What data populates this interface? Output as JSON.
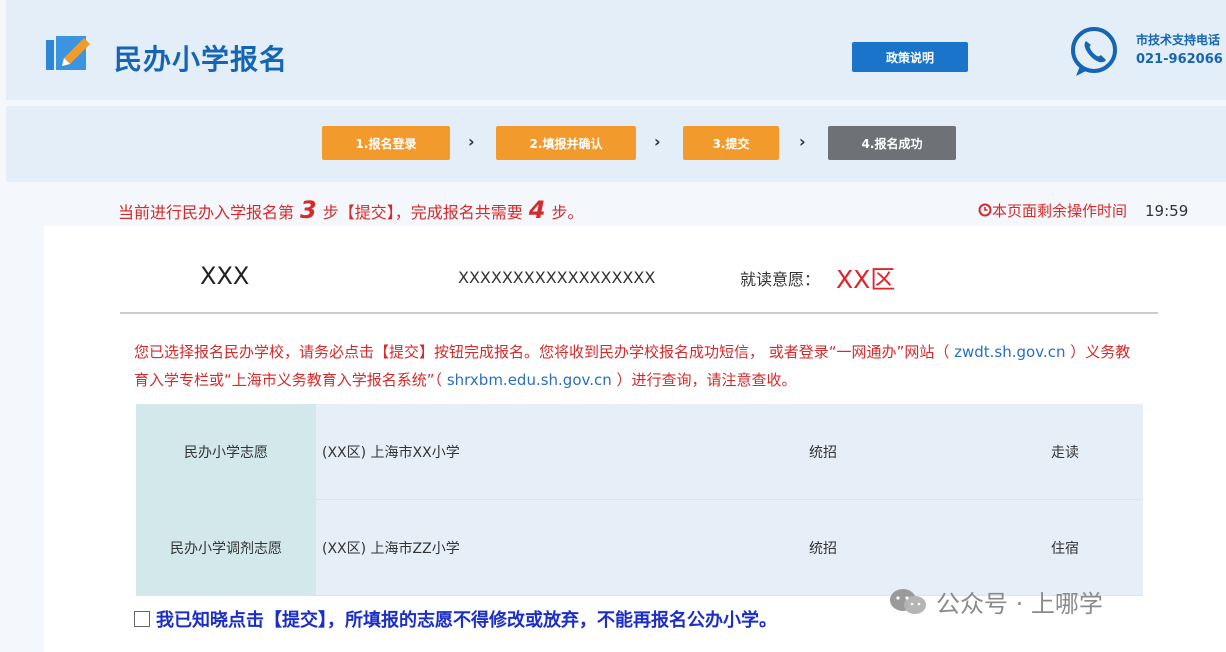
{
  "header": {
    "title": "民办小学报名",
    "policy_button": "政策说明",
    "support_label": "市技术支持电话",
    "support_phone": "021-962066"
  },
  "steps": [
    {
      "label": "1.报名登录",
      "state": "done"
    },
    {
      "label": "2.填报并确认",
      "state": "done"
    },
    {
      "label": "3.提交",
      "state": "done"
    },
    {
      "label": "4.报名成功",
      "state": "todo"
    }
  ],
  "step_arrow": "›",
  "progress": {
    "prefix": "当前进行民办入学报名第",
    "current": "3",
    "middle": "步【提交】，完成报名共需要",
    "total": "4",
    "suffix": "步。"
  },
  "timer": {
    "label": "本页面剩余操作时间",
    "value": "19:59"
  },
  "student": {
    "name": "XXX",
    "id": "XXXXXXXXXXXXXXXXXX",
    "wish_label": "就读意愿：",
    "wish_value": "XX区"
  },
  "notice": {
    "part1": "您已选择报名民办学校，请务必点击【提交】按钮完成报名。您将收到民办学校报名成功短信， 或者登录“一网通办”网站（",
    "link1": "zwdt.sh.gov.cn",
    "part2": "）义务教育入学专栏或“上海市义务教育入学报名系统”（",
    "link2": "shrxbm.edu.sh.gov.cn",
    "part3": "）进行查询，请注意查收。"
  },
  "choices": [
    {
      "label": "民办小学志愿",
      "school": "(XX区) 上海市XX小学",
      "type": "统招",
      "boarding": "走读"
    },
    {
      "label": "民办小学调剂志愿",
      "school": "(XX区) 上海市ZZ小学",
      "type": "统招",
      "boarding": "住宿"
    }
  ],
  "confirm_text": "我已知晓点击【提交】，所填报的志愿不得修改或放弃，不能再报名公办小学。",
  "watermark": "公众号 · 上哪学",
  "colors": {
    "primary": "#1565b4",
    "step_done": "#f39a2c",
    "step_todo": "#6e7175",
    "alert": "#d62b2b",
    "confirm": "#1c2ec8"
  }
}
